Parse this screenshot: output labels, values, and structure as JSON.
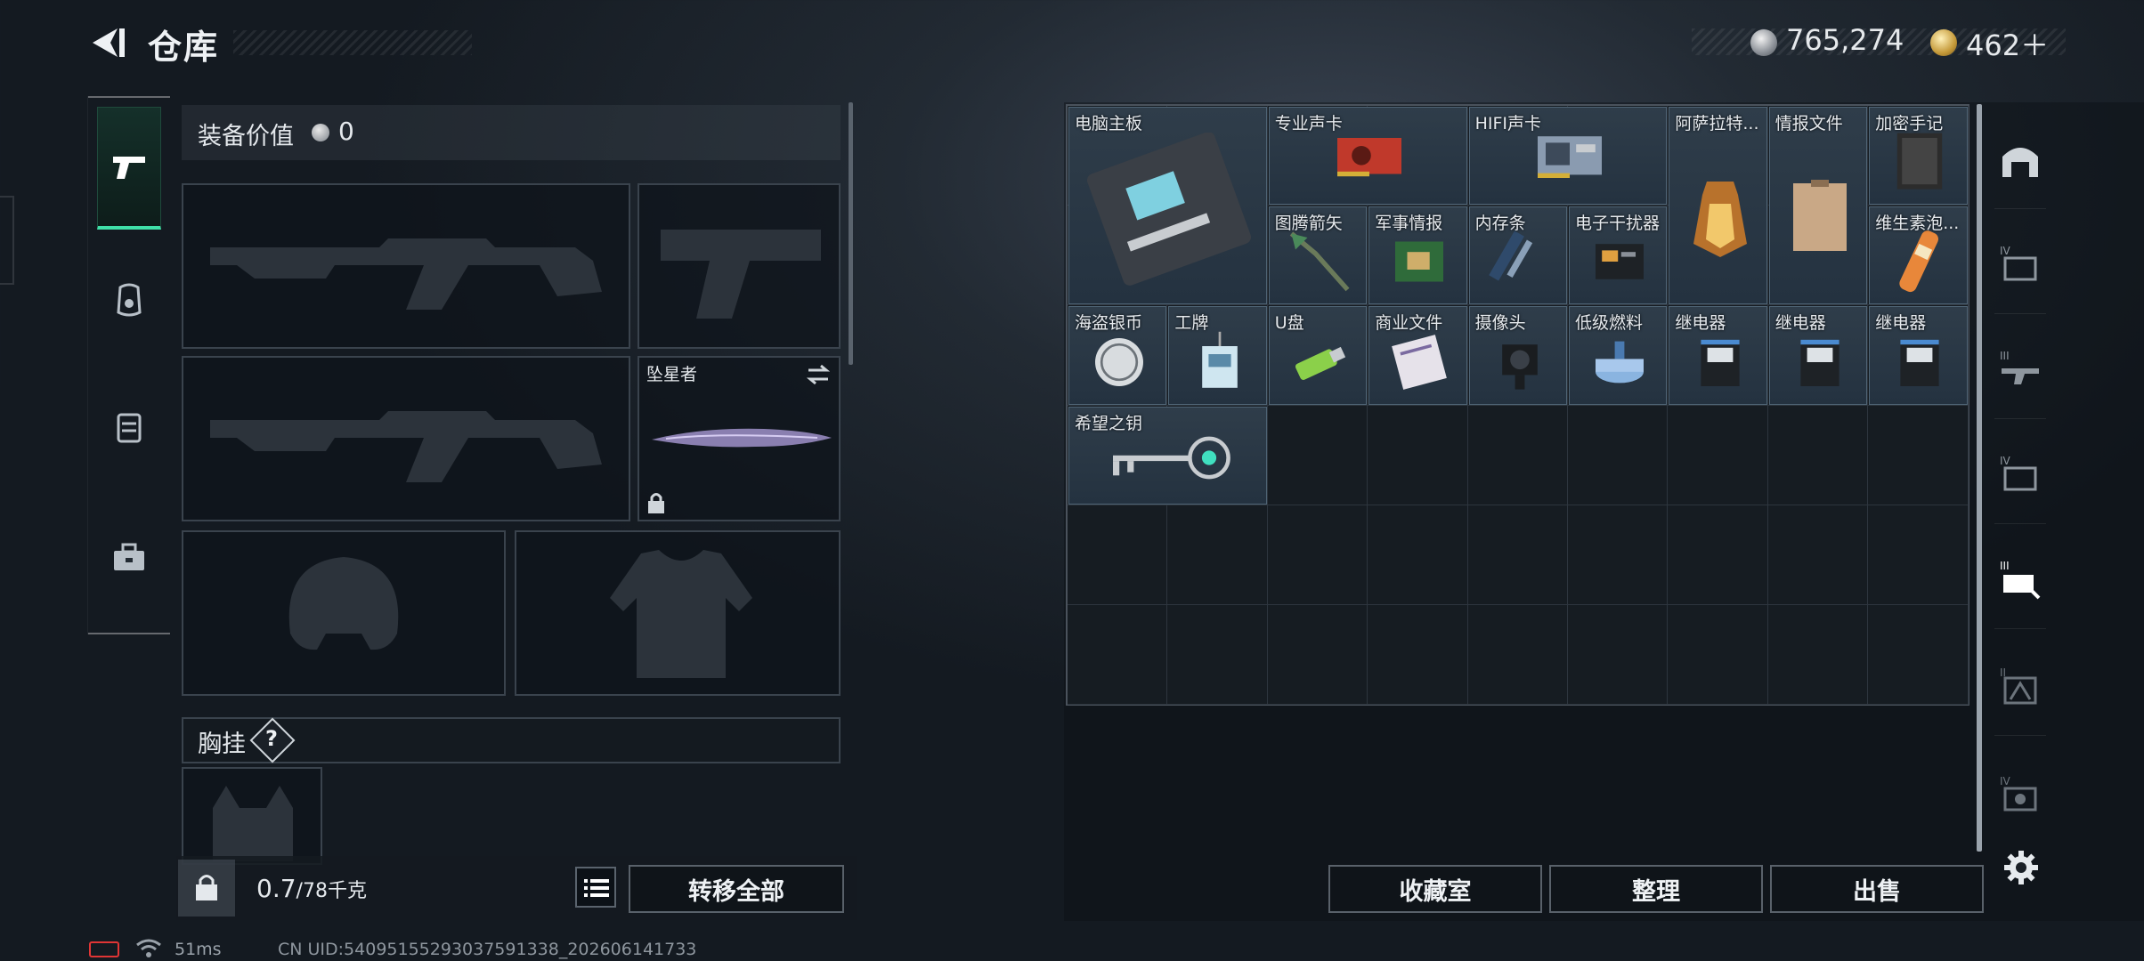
{
  "header": {
    "title": "仓库",
    "silver": "765,274",
    "gold": "462＋"
  },
  "equipment": {
    "value_label": "装备价值",
    "value": "0",
    "melee_name": "坠星者",
    "chest_label": "胸挂",
    "chest_help": "?"
  },
  "bottom_left": {
    "weight": "0.7",
    "weight_max": "/78千克",
    "transfer_label": "转移全部"
  },
  "storage": {
    "items": [
      {
        "name": "电脑主板"
      },
      {
        "name": "专业声卡"
      },
      {
        "name": "HIFI声卡"
      },
      {
        "name": "阿萨拉特..."
      },
      {
        "name": "情报文件"
      },
      {
        "name": "加密手记"
      },
      {
        "name": "图腾箭矢"
      },
      {
        "name": "军事情报"
      },
      {
        "name": "内存条"
      },
      {
        "name": "电子干扰器"
      },
      {
        "name": "维生素泡..."
      },
      {
        "name": "海盗银币"
      },
      {
        "name": "工牌"
      },
      {
        "name": "U盘"
      },
      {
        "name": "商业文件"
      },
      {
        "name": "摄像头"
      },
      {
        "name": "低级燃料"
      },
      {
        "name": "继电器"
      },
      {
        "name": "继电器"
      },
      {
        "name": "继电器"
      },
      {
        "name": "希望之钥"
      }
    ]
  },
  "buttons": {
    "collection": "收藏室",
    "sort": "整理",
    "sell": "出售"
  },
  "status": {
    "ping": "51ms",
    "uid": "CN UID:540951552930375913​38_202606141733"
  },
  "colors": {
    "active_tab_accent": "#3fe0a8",
    "item_bg": "#2f3d4a",
    "battery": "#e03535"
  }
}
